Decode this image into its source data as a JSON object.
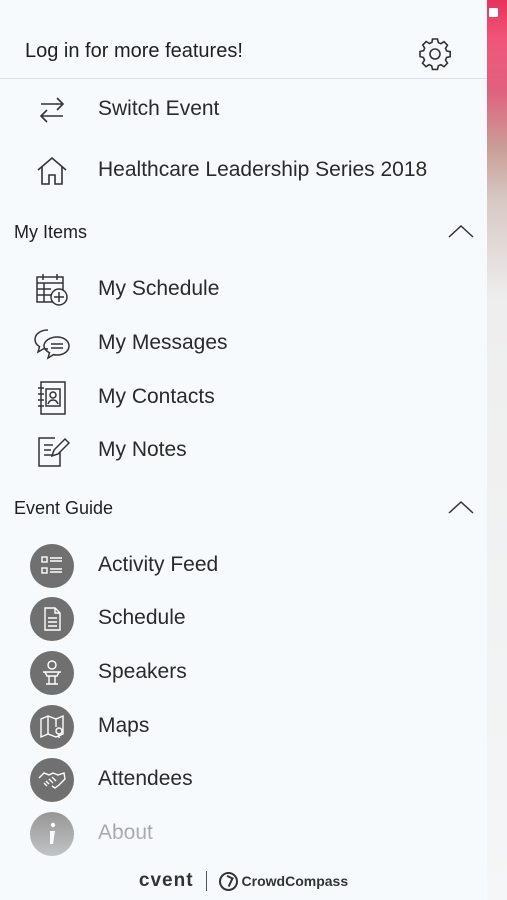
{
  "header": {
    "login_prompt": "Log in for more features!",
    "settings_icon": "gear-icon"
  },
  "top_items": [
    {
      "label": "Switch Event",
      "icon": "switch-arrows-icon"
    },
    {
      "label": "Healthcare Leadership Series 2018",
      "icon": "home-icon"
    }
  ],
  "my_items": {
    "title": "My Items",
    "items": [
      {
        "label": "My Schedule",
        "icon": "calendar-add-icon"
      },
      {
        "label": "My Messages",
        "icon": "chat-bubbles-icon"
      },
      {
        "label": "My Contacts",
        "icon": "contacts-book-icon"
      },
      {
        "label": "My Notes",
        "icon": "notes-pencil-icon"
      }
    ]
  },
  "event_guide": {
    "title": "Event Guide",
    "items": [
      {
        "label": "Activity Feed",
        "icon": "list-icon"
      },
      {
        "label": "Schedule",
        "icon": "document-icon"
      },
      {
        "label": "Speakers",
        "icon": "podium-icon"
      },
      {
        "label": "Maps",
        "icon": "map-pin-icon"
      },
      {
        "label": "Attendees",
        "icon": "handshake-icon"
      },
      {
        "label": "About",
        "icon": "info-icon"
      }
    ]
  },
  "footer": {
    "brand": "cvent",
    "partner": "CrowdCompass"
  },
  "colors": {
    "icon_circle": "#707070",
    "accent_edge": "#e8335a"
  }
}
